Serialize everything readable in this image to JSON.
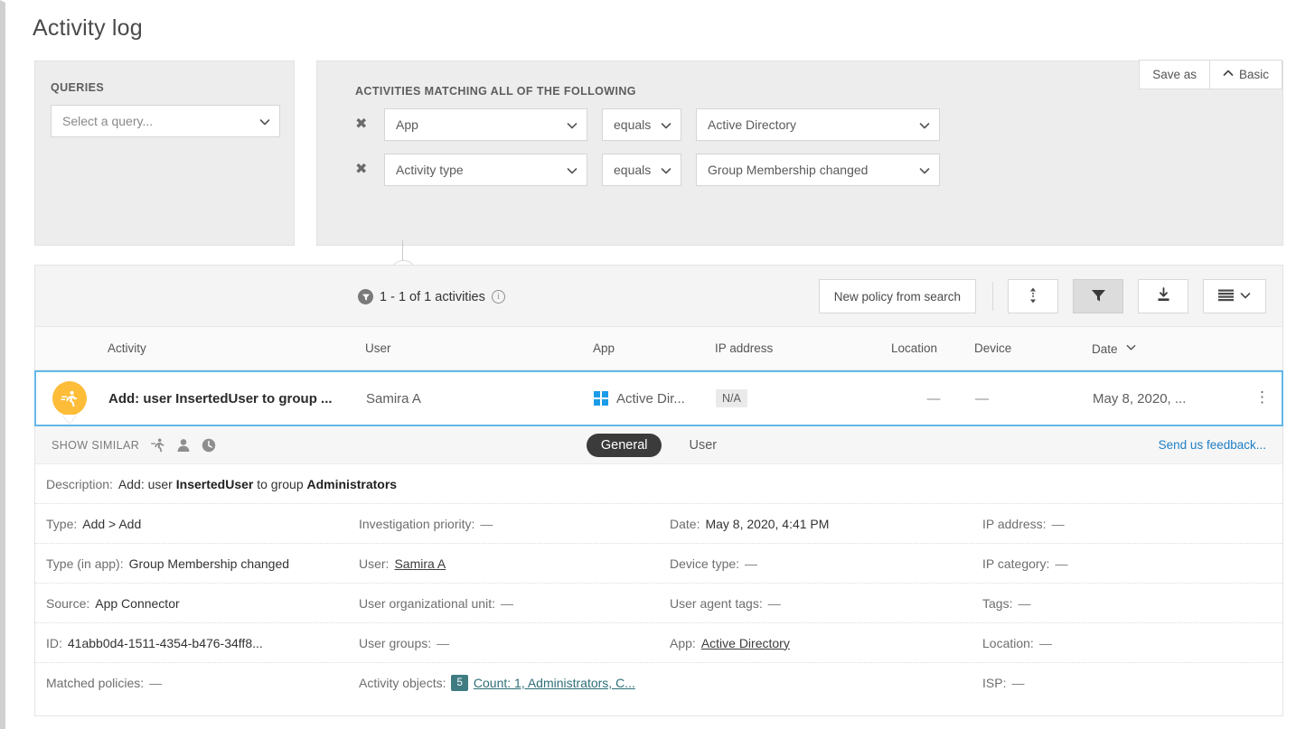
{
  "page": {
    "title": "Activity log"
  },
  "queries": {
    "label": "QUERIES",
    "select_value": "Select a query..."
  },
  "filters": {
    "label": "ACTIVITIES MATCHING ALL OF THE FOLLOWING",
    "save_as": "Save as",
    "basic": "Basic",
    "rows": [
      {
        "field": "App",
        "operator": "equals",
        "value": "Active Directory"
      },
      {
        "field": "Activity type",
        "operator": "equals",
        "value": "Group Membership changed"
      }
    ],
    "add_label": "+"
  },
  "toolbar": {
    "count_text": "1 - 1 of 1 activities",
    "new_policy": "New policy from search",
    "sort_icon": "sort-icon",
    "filter_icon": "filter-icon",
    "export_icon": "export-icon",
    "columns_icon": "columns-icon"
  },
  "table": {
    "columns": [
      "Activity",
      "User",
      "App",
      "IP address",
      "Location",
      "Device",
      "Date"
    ],
    "sort_column": "Date",
    "rows": [
      {
        "activity": "Add: user InsertedUser to group ...",
        "user": "Samira A",
        "app": "Active Dir...",
        "ip": "N/A",
        "location": "—",
        "device": "—",
        "date": "May 8, 2020, ..."
      }
    ]
  },
  "detail": {
    "show_similar_label": "SHOW SIMILAR",
    "tabs": [
      {
        "label": "General",
        "active": true
      },
      {
        "label": "User",
        "active": false
      }
    ],
    "feedback": "Send us feedback...",
    "description": {
      "label": "Description:",
      "pre": "Add: user ",
      "bold1": "InsertedUser",
      "mid": " to group ",
      "bold2": "Administrators"
    },
    "fields": [
      [
        {
          "label": "Type:",
          "value": "Add > Add",
          "style": "plain"
        },
        {
          "label": "Investigation priority:",
          "value": "—",
          "style": "dash"
        },
        {
          "label": "Date:",
          "value": "May 8, 2020, 4:41 PM",
          "style": "plain"
        },
        {
          "label": "IP address:",
          "value": "—",
          "style": "dash"
        }
      ],
      [
        {
          "label": "Type (in app):",
          "value": "Group Membership changed",
          "style": "plain"
        },
        {
          "label": "User:",
          "value": "Samira A",
          "style": "link"
        },
        {
          "label": "Device type:",
          "value": "—",
          "style": "dash"
        },
        {
          "label": "IP category:",
          "value": "—",
          "style": "dash"
        }
      ],
      [
        {
          "label": "Source:",
          "value": "App Connector",
          "style": "plain"
        },
        {
          "label": "User organizational unit:",
          "value": "—",
          "style": "dash"
        },
        {
          "label": "User agent tags:",
          "value": "—",
          "style": "dash"
        },
        {
          "label": "Tags:",
          "value": "—",
          "style": "dash"
        }
      ],
      [
        {
          "label": "ID:",
          "value": "41abb0d4-1511-4354-b476-34ff8...",
          "style": "plain"
        },
        {
          "label": "User groups:",
          "value": "—",
          "style": "dash"
        },
        {
          "label": "App:",
          "value": "Active Directory",
          "style": "link"
        },
        {
          "label": "Location:",
          "value": "—",
          "style": "dash"
        }
      ],
      [
        {
          "label": "Matched policies:",
          "value": "—",
          "style": "dash"
        },
        {
          "label": "Activity objects:",
          "value": "Count: 1, Administrators, C...",
          "style": "tealink",
          "badge": "5"
        },
        {
          "label": "",
          "value": "",
          "style": "plain"
        },
        {
          "label": "ISP:",
          "value": "—",
          "style": "dash"
        }
      ]
    ]
  },
  "colors": {
    "accent_blue": "#1f7fc4",
    "row_highlight": "#63b8e8",
    "activity_orange": "#fdbd39",
    "windows_blue": "#1c9ce8",
    "badge_teal": "#3f7c82"
  }
}
